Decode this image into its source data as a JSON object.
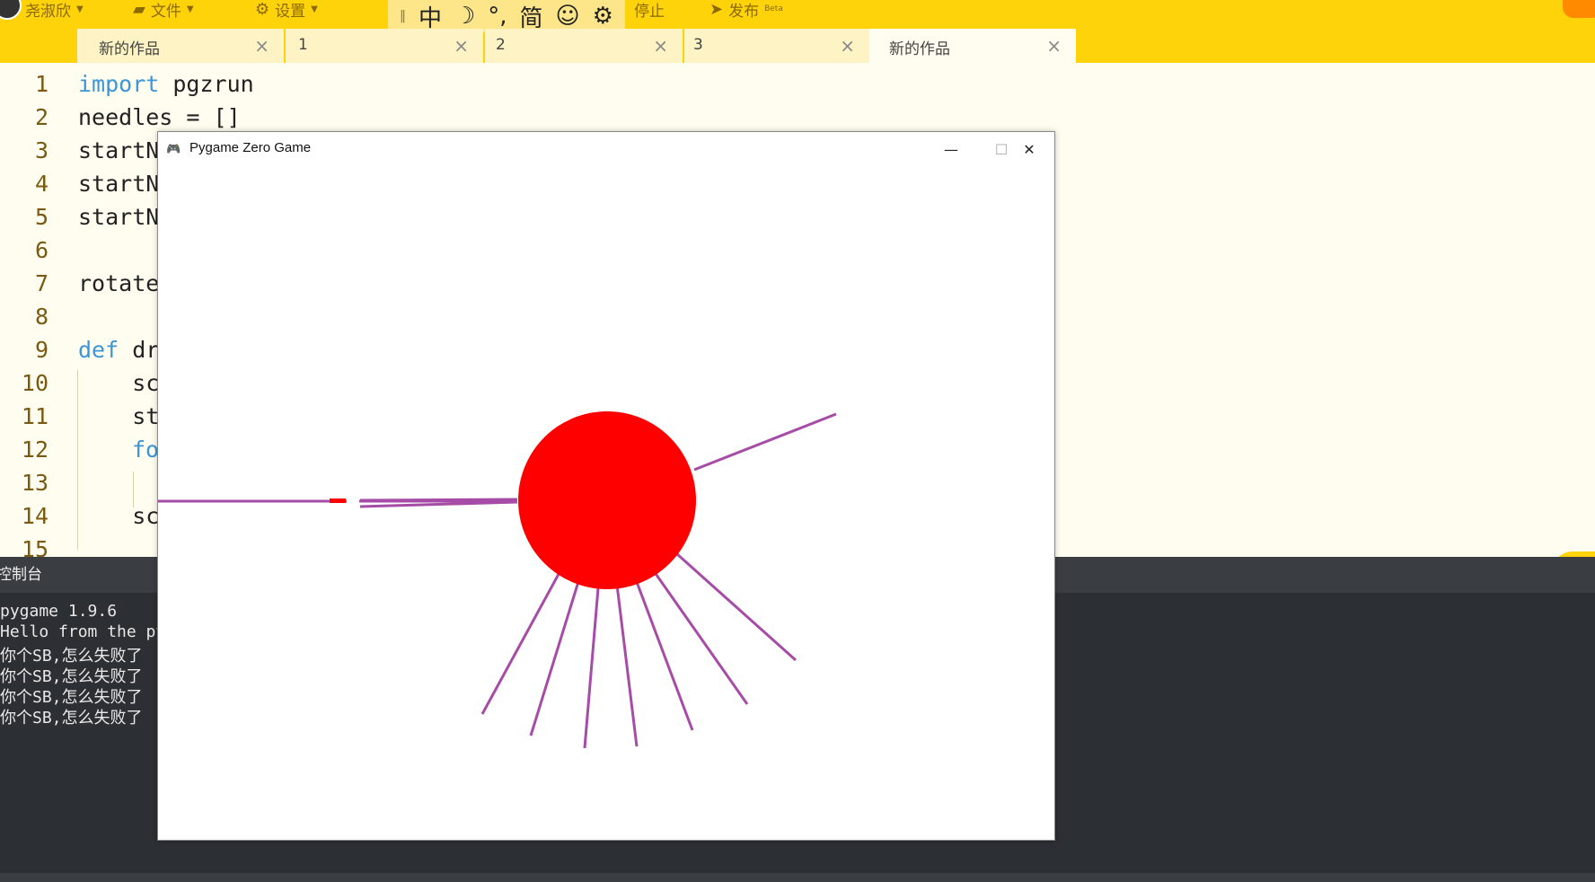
{
  "toolbar": {
    "user_name": "尧淑欣",
    "file_menu": "文件",
    "settings_menu": "设置",
    "stop_label": "停止",
    "publish_label": "发布",
    "publish_badge": "Beta"
  },
  "ime": {
    "mode": "中",
    "moon": "☽",
    "punct": "°,",
    "script": "简",
    "emoji": "☺",
    "gear": "⚙"
  },
  "tabs": [
    {
      "label": "新的作品",
      "close": "×"
    },
    {
      "label": "1",
      "close": "×"
    },
    {
      "label": "2",
      "close": "×"
    },
    {
      "label": "3",
      "close": "×"
    },
    {
      "label": "新的作品",
      "close": "×"
    }
  ],
  "code_lines": [
    {
      "num": "1",
      "kw": "import",
      "text": " pgzrun"
    },
    {
      "num": "2",
      "kw": "",
      "text": "needles = []"
    },
    {
      "num": "3",
      "kw": "",
      "text": "startN"
    },
    {
      "num": "4",
      "kw": "",
      "text": "startN"
    },
    {
      "num": "5",
      "kw": "",
      "text": "startN"
    },
    {
      "num": "6",
      "kw": "",
      "text": ""
    },
    {
      "num": "7",
      "kw": "",
      "text": "rotate"
    },
    {
      "num": "8",
      "kw": "",
      "text": ""
    },
    {
      "num": "9",
      "kw": "def",
      "text": " dr"
    },
    {
      "num": "10",
      "kw": "",
      "text": "    sc"
    },
    {
      "num": "11",
      "kw": "",
      "text": "    st"
    },
    {
      "num": "12",
      "kw": "fo",
      "text": ""
    },
    {
      "num": "13",
      "kw": "",
      "text": ""
    },
    {
      "num": "14",
      "kw": "",
      "text": "    sc"
    },
    {
      "num": "15",
      "kw": "",
      "text": ""
    }
  ],
  "console": {
    "header": "控制台",
    "lines": [
      "pygame 1.9.6",
      "Hello from the py",
      "你个SB,怎么失败了",
      "你个SB,怎么失败了",
      "你个SB,怎么失败了",
      "你个SB,怎么失败了"
    ]
  },
  "game_window": {
    "title": "Pygame Zero Game",
    "icon": "🎮",
    "minimize": "—",
    "maximize": "☐",
    "close": "✕",
    "colors": {
      "sun": "#ff0000",
      "needle": "#a64ca6",
      "background": "#ffffff"
    }
  },
  "colors": {
    "toolbar": "#ffd30a",
    "editor_bg": "#fffdf0",
    "keyword": "#3b95d6",
    "console_bg": "#2c2f33"
  }
}
